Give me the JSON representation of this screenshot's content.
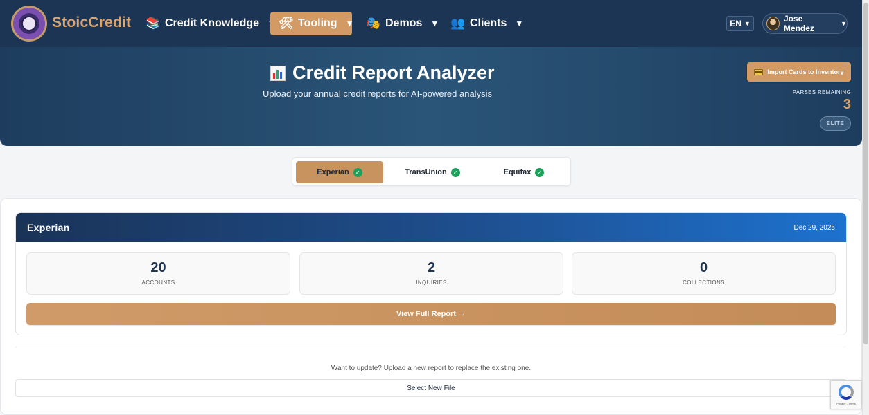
{
  "nav": {
    "brand": "StoicCredit",
    "items": [
      {
        "label": "Credit Knowledge",
        "icon": "books-icon"
      },
      {
        "label": "Tooling",
        "icon": "tools-icon",
        "active": true
      },
      {
        "label": "Demos",
        "icon": "theater-masks-icon"
      },
      {
        "label": "Clients",
        "icon": "people-icon"
      }
    ],
    "language": "EN",
    "user_name": "Jose Mendez"
  },
  "hero": {
    "title": "Credit Report Analyzer",
    "subtitle": "Upload your annual credit reports for AI-powered analysis",
    "import_button": "Import Cards to Inventory",
    "parses_label": "PARSES REMAINING",
    "parses_count": "3",
    "tier": "ELITE"
  },
  "bureaus": [
    {
      "label": "Experian",
      "active": true,
      "verified": true
    },
    {
      "label": "TransUnion",
      "active": false,
      "verified": true
    },
    {
      "label": "Equifax",
      "active": false,
      "verified": true
    }
  ],
  "report": {
    "bureau": "Experian",
    "date": "Dec 29, 2025",
    "stats": [
      {
        "value": "20",
        "label": "ACCOUNTS"
      },
      {
        "value": "2",
        "label": "INQUIRIES"
      },
      {
        "value": "0",
        "label": "COLLECTIONS"
      }
    ],
    "view_button": "View Full Report →"
  },
  "upload": {
    "prompt": "Want to update? Upload a new report to replace the existing one.",
    "select_button": "Select New File"
  },
  "recaptcha": {
    "footer": "Privacy - Terms"
  },
  "colors": {
    "nav_bg": "#1c3554",
    "accent": "#d29a64",
    "brand_text": "#d9a470",
    "success": "#1ea05a",
    "report_header_start": "#1a3357",
    "report_header_end": "#1d72cf"
  }
}
